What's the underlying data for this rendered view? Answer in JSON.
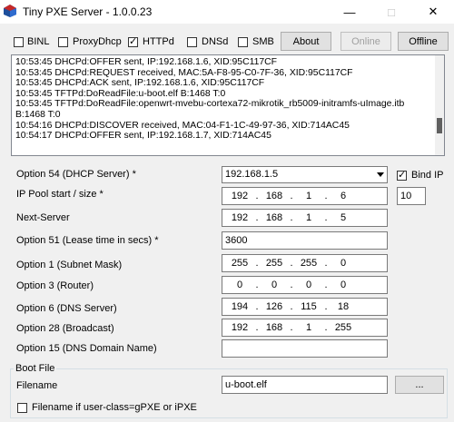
{
  "window": {
    "title": "Tiny PXE Server - 1.0.0.23",
    "min": "—",
    "max": "□",
    "close": "✕"
  },
  "toolbar": {
    "checks": [
      {
        "label": "BINL",
        "checked": false
      },
      {
        "label": "ProxyDhcp",
        "checked": false
      },
      {
        "label": "HTTPd",
        "checked": true
      },
      {
        "label": "DNSd",
        "checked": false
      },
      {
        "label": "SMB",
        "checked": false
      }
    ],
    "about": "About",
    "online": "Online",
    "offline": "Offline"
  },
  "log": [
    "10:53:45 DHCPd:OFFER sent, IP:192.168.1.6, XID:95C117CF",
    "10:53:45 DHCPd:REQUEST received, MAC:5A-F8-95-C0-7F-36, XID:95C117CF",
    "10:53:45 DHCPd:ACK sent, IP:192.168.1.6, XID:95C117CF",
    "10:53:45 TFTPd:DoReadFile:u-boot.elf B:1468 T:0",
    "10:53:45 TFTPd:DoReadFile:openwrt-mvebu-cortexa72-mikrotik_rb5009-initramfs-uImage.itb",
    "B:1468 T:0",
    "10:54:16 DHCPd:DISCOVER received, MAC:04-F1-1C-49-97-36, XID:714AC45",
    "10:54:17 DHCPd:OFFER sent, IP:192.168.1.7, XID:714AC45"
  ],
  "fields": {
    "opt54_label": "Option 54 (DHCP Server) *",
    "opt54_value": "192.168.1.5",
    "bind_ip": "Bind IP",
    "pool_label": "IP Pool start / size *",
    "pool_ip": [
      "192",
      "168",
      "1",
      "6"
    ],
    "pool_size": "10",
    "next_label": "Next-Server",
    "next_ip": [
      "192",
      "168",
      "1",
      "5"
    ],
    "opt51_label": "Option 51 (Lease time in secs) *",
    "opt51_value": "3600",
    "opt1_label": "Option 1  (Subnet Mask)",
    "opt1_ip": [
      "255",
      "255",
      "255",
      "0"
    ],
    "opt3_label": "Option 3  (Router)",
    "opt3_ip": [
      "0",
      "0",
      "0",
      "0"
    ],
    "opt6_label": "Option 6  (DNS Server)",
    "opt6_ip": [
      "194",
      "126",
      "115",
      "18"
    ],
    "opt28_label": "Option 28 (Broadcast)",
    "opt28_ip": [
      "192",
      "168",
      "1",
      "255"
    ],
    "opt15_label": "Option 15 (DNS Domain Name)",
    "opt15_value": ""
  },
  "bootfile": {
    "group": "Boot File",
    "filename_label": "Filename",
    "filename_value": "u-boot.elf",
    "browse": "...",
    "userclass_label": "Filename if user-class=gPXE or iPXE"
  },
  "colors": {
    "icon_red": "#c62828",
    "icon_blue": "#1e4f9c"
  },
  "icons": {
    "app": "pxe-app-icon"
  }
}
